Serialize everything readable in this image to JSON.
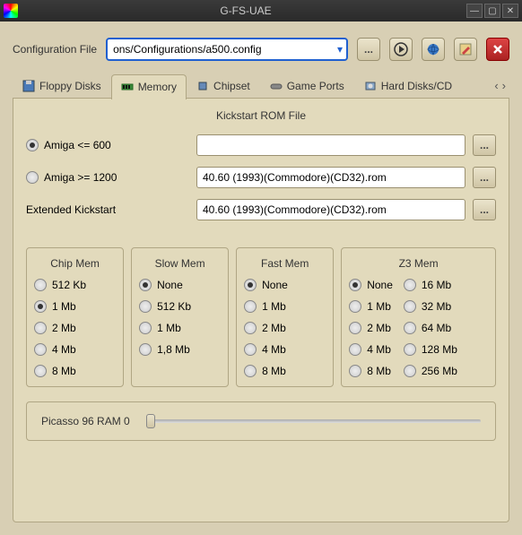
{
  "window": {
    "title": "G-FS-UAE"
  },
  "config": {
    "label": "Configuration File",
    "value": "ons/Configurations/a500.config"
  },
  "tabs": {
    "items": [
      {
        "label": "Floppy Disks"
      },
      {
        "label": "Memory"
      },
      {
        "label": "Chipset"
      },
      {
        "label": "Game Ports"
      },
      {
        "label": "Hard Disks/CD"
      }
    ]
  },
  "rom": {
    "title": "Kickstart ROM File",
    "amiga600_label": "Amiga <= 600",
    "amiga600_value": "",
    "amiga1200_label": "Amiga >= 1200",
    "amiga1200_value": "40.60 (1993)(Commodore)(CD32).rom",
    "ext_label": "Extended Kickstart",
    "ext_value": "40.60 (1993)(Commodore)(CD32).rom",
    "browse": "..."
  },
  "mem": {
    "chip": {
      "title": "Chip Mem",
      "opts": [
        "512 Kb",
        "1 Mb",
        "2 Mb",
        "4 Mb",
        "8 Mb"
      ],
      "sel": 1
    },
    "slow": {
      "title": "Slow Mem",
      "opts": [
        "None",
        "512 Kb",
        "1 Mb",
        "1,8 Mb"
      ],
      "sel": 0
    },
    "fast": {
      "title": "Fast Mem",
      "opts": [
        "None",
        "1 Mb",
        "2 Mb",
        "4 Mb",
        "8 Mb"
      ],
      "sel": 0
    },
    "z3": {
      "title": "Z3 Mem",
      "colA": [
        "None",
        "1 Mb",
        "2 Mb",
        "4 Mb",
        "8 Mb"
      ],
      "colB": [
        "16 Mb",
        "32 Mb",
        "64 Mb",
        "128 Mb",
        "256 Mb"
      ],
      "sel": 0
    }
  },
  "picasso": {
    "label": "Picasso 96 RAM 0"
  }
}
